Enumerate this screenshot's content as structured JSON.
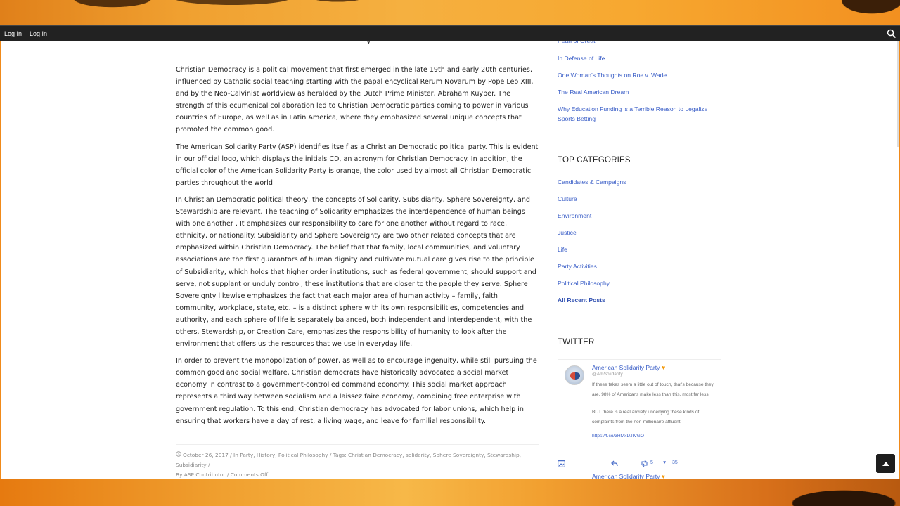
{
  "nav": {
    "links": [
      "Log In",
      "Log In"
    ]
  },
  "article": {
    "paragraphs": [
      "Christian Democracy is a political movement that first emerged in the late 19th and early 20th centuries, influenced by Catholic social teaching starting with the papal encyclical Rerum Novarum by Pope Leo XIII, and by the Neo-Calvinist worldview as heralded by the Dutch Prime Minister, Abraham Kuyper. The strength of this ecumenical collaboration led to Christian Democratic parties coming to power in various countries of Europe, as well as in Latin America, where they emphasized several unique concepts that promoted the common good.",
      "The American Solidarity Party (ASP) identifies itself as a Christian Democratic political party. This is evident in our official logo, which displays the initials CD, an acronym for Christian Democracy. In addition, the official color of the American Solidarity Party is orange, the color used by almost all Christian Democratic parties throughout the world.",
      "In Christian Democratic political theory, the concepts of Solidarity, Subsidiarity, Sphere Sovereignty, and Stewardship are relevant. The teaching of Solidarity emphasizes the interdependence of human beings with one another . It emphasizes our responsibility to care for one another without regard to race, ethnicity, or nationality. Subsidiarity and Sphere Sovereignty are two other related concepts that are emphasized within Christian Democracy. The belief that that family, local communities, and voluntary associations are the first guarantors of human dignity and cultivate mutual care gives rise to the principle of Subsidiarity, which holds that higher order institutions, such as federal government, should support and serve, not supplant or unduly control, these institutions that are closer to the people they serve. Sphere Sovereignty likewise emphasizes the fact that each major area of human activity – family, faith community, workplace, state, etc. – is a distinct sphere with its own responsibilities, competencies and authority, and each sphere of life is separately balanced, both independent and interdependent, with the others. Stewardship, or Creation Care, emphasizes the responsibility of humanity to look after the environment that offers us the resources that we use in everyday life.",
      "In order to prevent the monopolization of power, as well as to encourage ingenuity, while still pursuing the common good and social welfare, Christian democrats have historically advocated a social market economy in contrast to a government-controlled command economy. This social market approach represents a third way between socialism and a laissez faire economy, combining free enterprise with government regulation. To this end, Christian democracy has advocated for labor unions, which help in ensuring that workers have a day of rest, a living wage, and leave for familial responsibility."
    ],
    "meta_line1": "October 26, 2017 / In Party, History, Political Philosophy / Tags: Christian Democracy, solidarity, Sphere Sovereignty, Stewardship, Subsidiarity /",
    "meta_line2": "By ASP Contributor / Comments Off"
  },
  "sidebar": {
    "recent_posts": [
      "In Defense of Life",
      "One Woman's Thoughts on Roe v. Wade",
      "The Real American Dream",
      "Why Education Funding is a Terrible Reason to Legalize Sports Betting"
    ],
    "categories_title": "TOP CATEGORIES",
    "categories": [
      "Candidates & Campaigns",
      "Culture",
      "Environment",
      "Justice",
      "Life",
      "Party Activities",
      "Political Philosophy"
    ],
    "all_posts_label": "All Recent Posts",
    "twitter_title": "TWITTER",
    "tweet": {
      "name": "American Solidarity Party",
      "handle": "@AmSolidarity",
      "text1": "If these takes seem a little out of touch, that's because they are. 98% of Americans make less than this, most far less.",
      "text2": "BUT there is a real anxiety underlying these kinds of complaints from the non-millionaire affluent.",
      "link": "https://t.co/3HMxDJIVGO",
      "retweets": "5",
      "likes": "35"
    },
    "next_tweet_name": "American Solidarity Party"
  },
  "colors": {
    "link": "#3a5ec7",
    "nav_bg": "#222222",
    "brand_orange": "#f39c12"
  }
}
